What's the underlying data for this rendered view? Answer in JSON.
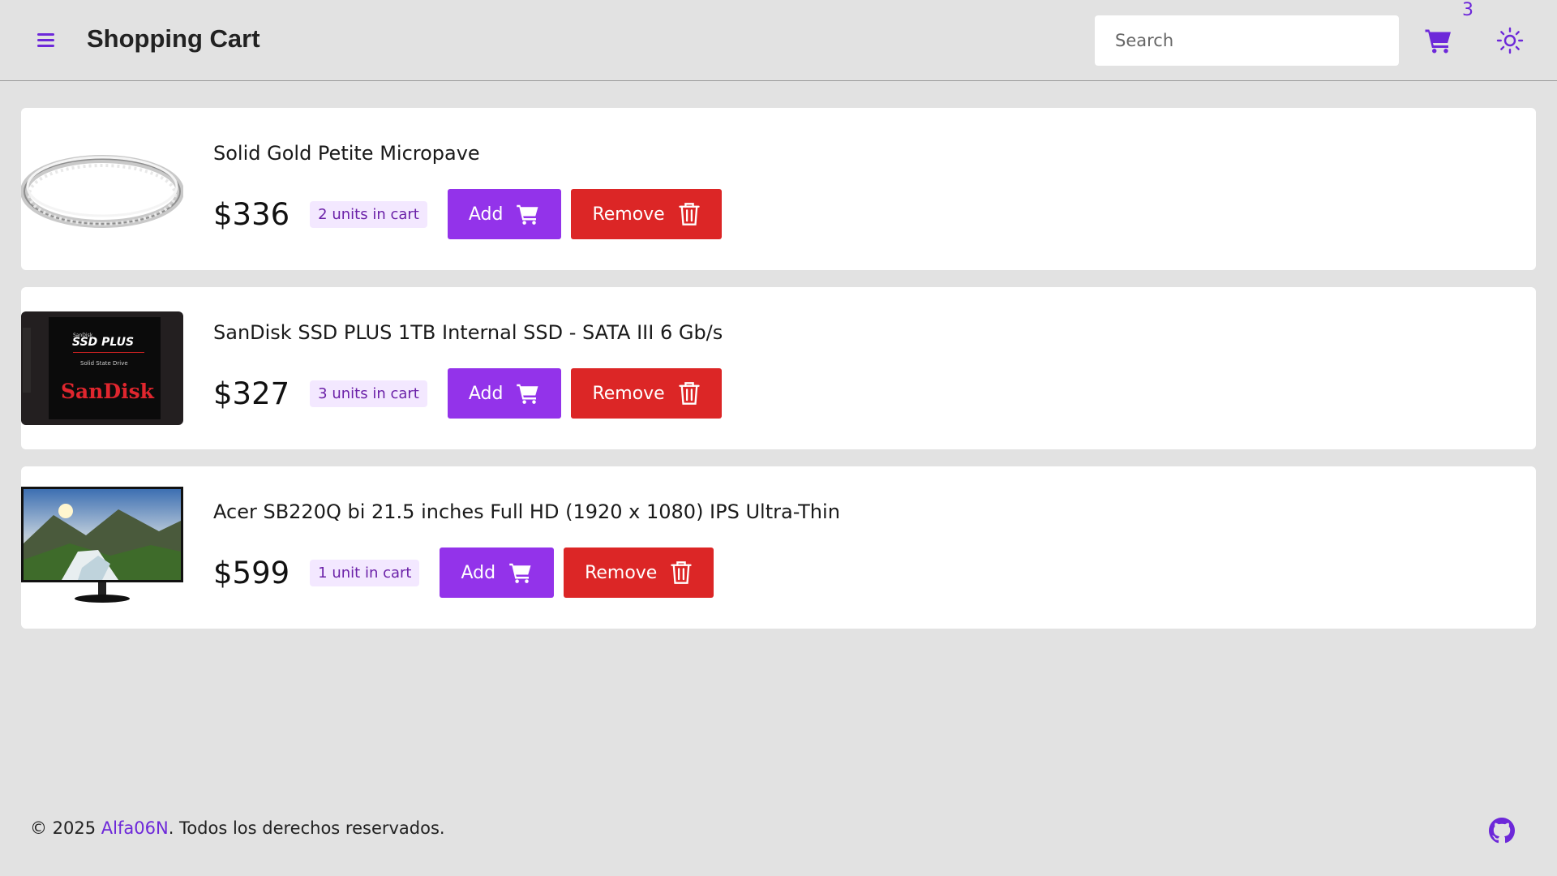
{
  "header": {
    "title": "Shopping Cart",
    "search_placeholder": "Search",
    "cart_count": "3",
    "menu_icon": "hamburger-menu-icon",
    "cart_icon": "cart-icon",
    "theme_icon": "sun-icon"
  },
  "colors": {
    "accent": "#9333ea",
    "danger": "#dc2626",
    "badge_bg": "#f3e8ff",
    "badge_text": "#6b21a8",
    "background": "#e2e2e2"
  },
  "products": [
    {
      "name": "Solid Gold Petite Micropave",
      "price": "$336",
      "units": "2 units in cart",
      "add_label": "Add",
      "remove_label": "Remove",
      "image": "ring-image"
    },
    {
      "name": "SanDisk SSD PLUS 1TB Internal SSD - SATA III 6 Gb/s",
      "price": "$327",
      "units": "3 units in cart",
      "add_label": "Add",
      "remove_label": "Remove",
      "image": "ssd-image",
      "image_text": {
        "brand_small": "SanDisk",
        "product": "SSD PLUS",
        "subtitle": "Solid State Drive",
        "brand": "SanDisk"
      }
    },
    {
      "name": "Acer SB220Q bi 21.5 inches Full HD (1920 x 1080) IPS Ultra-Thin",
      "price": "$599",
      "units": "1 unit in cart",
      "add_label": "Add",
      "remove_label": "Remove",
      "image": "monitor-image"
    }
  ],
  "footer": {
    "copyright": "© 2025 ",
    "author": "Alfa06N",
    "rights": ". Todos los derechos reservados.",
    "github_icon": "github-icon"
  }
}
